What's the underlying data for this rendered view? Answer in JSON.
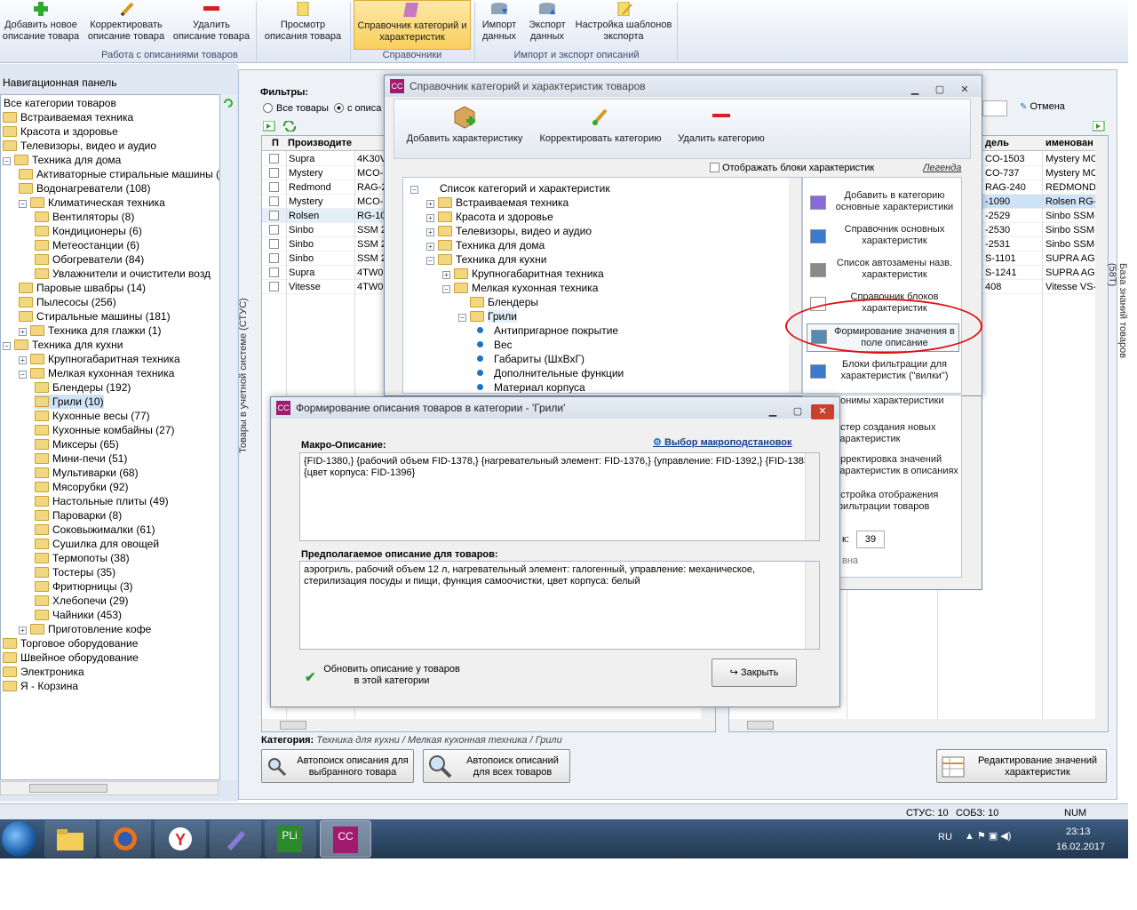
{
  "ribbon": {
    "buttons": [
      {
        "label": "Добавить новое описание товара"
      },
      {
        "label": "Корректировать описание товара"
      },
      {
        "label": "Удалить описание товара"
      },
      {
        "label": "Просмотр описания товара"
      },
      {
        "label": "Справочник категорий и характеристик"
      },
      {
        "label": "Импорт данных"
      },
      {
        "label": "Экспорт данных"
      },
      {
        "label": "Настройка шаблонов экспорта"
      }
    ],
    "groups": [
      "Работа с описаниями товаров",
      "Справочники",
      "Импорт и экспорт описаний"
    ]
  },
  "nav": {
    "title": "Навигационная панель",
    "items": [
      "Все категории товаров",
      "Встраиваемая техника",
      "Красота и здоровье",
      "Телевизоры, видео и аудио",
      "Техника для дома",
      "Активаторные стиральные машины (",
      "Водонагреватели (108)",
      "Климатическая техника",
      "Вентиляторы (8)",
      "Кондиционеры (6)",
      "Метеостанции (6)",
      "Обогреватели (84)",
      "Увлажнители и очистители возд",
      "Паровые швабры (14)",
      "Пылесосы (256)",
      "Стиральные машины (181)",
      "Техника для глажки (1)",
      "Техника для кухни",
      "Крупногабаритная техника",
      "Мелкая кухонная техника",
      "Блендеры (192)",
      "Грили (10)",
      "Кухонные весы (77)",
      "Кухонные комбайны (27)",
      "Миксеры (65)",
      "Мини-печи (51)",
      "Мультиварки (68)",
      "Мясорубки (92)",
      "Настольные плиты (49)",
      "Пароварки (8)",
      "Соковыжималки (61)",
      "Сушилка для овощей",
      "Термопоты (38)",
      "Тостеры (35)",
      "Фритюрницы (3)",
      "Хлебопечи (29)",
      "Чайники (453)",
      "Приготовление кофе",
      "Торговое оборудование",
      "Швейное оборудование",
      "Электроника",
      "Я - Корзина"
    ]
  },
  "main": {
    "side_tab": "Товары в учетной системе (СТУС)",
    "filters_label": "Фильтры:",
    "radio_all": "Все товары",
    "radio_desc": "с описа",
    "col_p": "П",
    "col_manuf": "Производите",
    "rows": [
      {
        "manuf": "Supra",
        "code": "4K30V"
      },
      {
        "manuf": "Mystery",
        "code": "MCO-"
      },
      {
        "manuf": "Redmond",
        "code": "RAG-2"
      },
      {
        "manuf": "Mystery",
        "code": "MCO-"
      },
      {
        "manuf": "Rolsen",
        "code": "RG-10"
      },
      {
        "manuf": "Sinbo",
        "code": "SSM 2"
      },
      {
        "manuf": "Sinbo",
        "code": "SSM 2"
      },
      {
        "manuf": "Sinbo",
        "code": "SSM 2"
      },
      {
        "manuf": "Supra",
        "code": "4TW0"
      },
      {
        "manuf": "Vitesse",
        "code": "4TW0"
      }
    ],
    "category_label": "Категория:",
    "category_path": "Техника для кухни / Мелкая кухонная техника / Грили",
    "btn_autosearch_one": "Автопоиск описания для выбранного товара",
    "btn_autosearch_all": "Автопоиск описаний для всех товаров"
  },
  "right": {
    "cancel": "Отмена",
    "col_model": "дель",
    "col_name": "именован",
    "side_tab": "База знаний товаров (58Т)",
    "rows": [
      {
        "model": "CO-1503",
        "name": "Mystery MC"
      },
      {
        "model": "CO-737",
        "name": "Mystery MC"
      },
      {
        "model": "RAG-240",
        "name": "REDMOND"
      },
      {
        "model": "-1090",
        "name": "Rolsen RG-"
      },
      {
        "model": "-2529",
        "name": "Sinbo SSM-"
      },
      {
        "model": "-2530",
        "name": "Sinbo SSM-"
      },
      {
        "model": "-2531",
        "name": "Sinbo SSM-"
      },
      {
        "model": "S-1101",
        "name": "SUPRA AGS"
      },
      {
        "model": "S-1241",
        "name": "SUPRA AGS"
      },
      {
        "model": "408",
        "name": "Vitesse VS-"
      }
    ],
    "btn_edit": "Редактирование значений характеристик"
  },
  "catwin": {
    "title": "Справочник категорий и характеристик товаров",
    "tb_add": "Добавить характеристику",
    "tb_edit": "Корректировать категорию",
    "tb_delete": "Удалить категорию",
    "show_blocks": "Отображать блоки характеристик",
    "legend": "Легенда",
    "tree": [
      "Список категорий и характеристик",
      "Встраиваемая техника",
      "Красота и здоровье",
      "Телевизоры, видео и аудио",
      "Техника для дома",
      "Техника для кухни",
      "Крупногабаритная техника",
      "Мелкая кухонная техника",
      "Блендеры",
      "Грили",
      "Антипригарное покрытие",
      "Вес",
      "Габариты (ШхВхГ)",
      "Дополнительные функции",
      "Материал корпуса"
    ],
    "side": [
      "Добавить в категорию основные характеристики",
      "Справочник основных характеристик",
      "Список автозамены назв. характеристик",
      "Справочник блоков характеристик",
      "Формирование значения в поле описание",
      "Блоки фильтрации для характеристик (\"вилки\")",
      "нонимы характеристики",
      "астер создания новых характеристик",
      "орректировка значений характеристик в описаниях",
      "астройка отображения фильтрации товаров"
    ],
    "count_label": "к:",
    "count_value": "39",
    "trailing": "вна"
  },
  "descwin": {
    "title": "Формирование описания товаров в категории - 'Грили'",
    "macro_label": "Макро-Описание:",
    "macro_link": "Выбор макроподстановок",
    "macro_text": "{FID-1380,} {рабочий объем FID-1378,} {нагревательный элемент: FID-1376,} {управление: FID-1392,} {FID-1383,} {цвет корпуса: FID-1396}",
    "preview_label": "Предполагаемое описание для товаров:",
    "preview_text": "аэрогриль, рабочий объем 12 л, нагревательный элемент: галогенный, управление: механическое, стерилизация посуды и пищи, функция самоочистки, цвет корпуса: белый",
    "update_label": "Обновить описание у товаров в этой категории",
    "close_label": "Закрыть"
  },
  "status": {
    "stus": "СТУС: 10",
    "sobz": "СОБЗ: 10",
    "num": "NUM"
  },
  "taskbar": {
    "lang": "RU",
    "time": "23:13",
    "date": "16.02.2017"
  },
  "colors": {
    "accent": "#1e72c8",
    "highlight": "#cfe3f7",
    "circle": "#e01010",
    "brand": "#a01a6e"
  }
}
